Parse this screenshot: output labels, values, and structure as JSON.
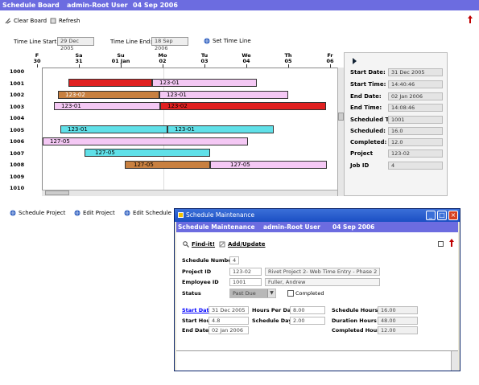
{
  "titlebar": {
    "app": "Schedule Board",
    "user": "admin-Root User",
    "date": "04 Sep 2006"
  },
  "toolbar": {
    "clear_label": "Clear Board",
    "refresh_label": "Refresh"
  },
  "timeline": {
    "start_label": "Time Line Start:",
    "start_value": "29 Dec 2005",
    "end_label": "Time Line End:",
    "end_value": "18 Sep 2006",
    "set_label": "Set Time Line"
  },
  "days": [
    {
      "dow": "F",
      "num": "30"
    },
    {
      "dow": "Sa",
      "num": "31"
    },
    {
      "dow": "Su",
      "num": "01 Jan"
    },
    {
      "dow": "Mo",
      "num": "02"
    },
    {
      "dow": "Tu",
      "num": "03"
    },
    {
      "dow": "We",
      "num": "04"
    },
    {
      "dow": "Th",
      "num": "05"
    },
    {
      "dow": "Fr",
      "num": "06"
    }
  ],
  "rows": [
    "1000",
    "1001",
    "1002",
    "1003",
    "1004",
    "1005",
    "1006",
    "1007",
    "1008",
    "1009",
    "1010"
  ],
  "bars": {
    "b1a": "",
    "b1b": "123-01",
    "b2a": "123-02",
    "b2b": "123-01",
    "b3a": "123-01",
    "b3b": "123-02",
    "b5a": "123-01",
    "b5b": "123-01",
    "b6a": "127-05",
    "b7a": "127-05",
    "b8a": "127-05",
    "b8b": "127-05"
  },
  "details": {
    "start_date_label": "Start Date:",
    "start_date": "31 Dec 2005",
    "start_time_label": "Start Time:",
    "start_time": "14:40:46",
    "end_date_label": "End Date:",
    "end_date": "02 Jan 2006",
    "end_time_label": "End Time:",
    "end_time": "14:08:46",
    "scheduled_to_label": "Scheduled To:",
    "scheduled_to": "1001",
    "scheduled_label": "Scheduled:",
    "scheduled": "16.0",
    "completed_label": "Completed:",
    "completed": "12.0",
    "project_label": "Project",
    "project": "123-02",
    "job_label": "Job ID",
    "job": "4"
  },
  "actions": {
    "schedule_project": "Schedule Project",
    "edit_project": "Edit Project",
    "edit_schedule": "Edit Schedule"
  },
  "dialog": {
    "title": "Schedule Maintenance",
    "header_title": "Schedule Maintenance",
    "header_user": "admin-Root User",
    "header_date": "04 Sep 2006",
    "findit_label": "Find-it!",
    "addupdate_label": "Add/Update",
    "schedule_number_label": "Schedule Number",
    "schedule_number": "4",
    "project_id_label": "Project ID",
    "project_id": "123-02",
    "project_name": "Rivet Project 2- Web Time Entry - Phase 2",
    "employee_id_label": "Employee ID",
    "employee_id": "1001",
    "employee_name": "Fuller, Andrew",
    "status_label": "Status",
    "status": "Past Due",
    "completed_label": "Completed",
    "start_date_label": "Start Date",
    "start_date": "31 Dec 2005",
    "hours_per_day_label": "Hours Per Day",
    "hours_per_day": "8.00",
    "schedule_hours_label": "Schedule Hours",
    "schedule_hours": "16.00",
    "start_hour_label": "Start Hour",
    "start_hour": "4.8",
    "schedule_days_label": "Schedule Days",
    "schedule_days": "2.00",
    "duration_hours_label": "Duration Hours",
    "duration_hours": "48.00",
    "end_date_label": "End Date",
    "end_date": "02 Jan 2006",
    "completed_hours_label": "Completed Hours",
    "completed_hours": "12.00"
  },
  "colors": {
    "titlebar": "#6c6ce0",
    "red_bar": "#e02020",
    "orange_bar": "#c88040",
    "pink_bar": "#f4c8f4",
    "cyan_bar": "#60e0e8"
  }
}
